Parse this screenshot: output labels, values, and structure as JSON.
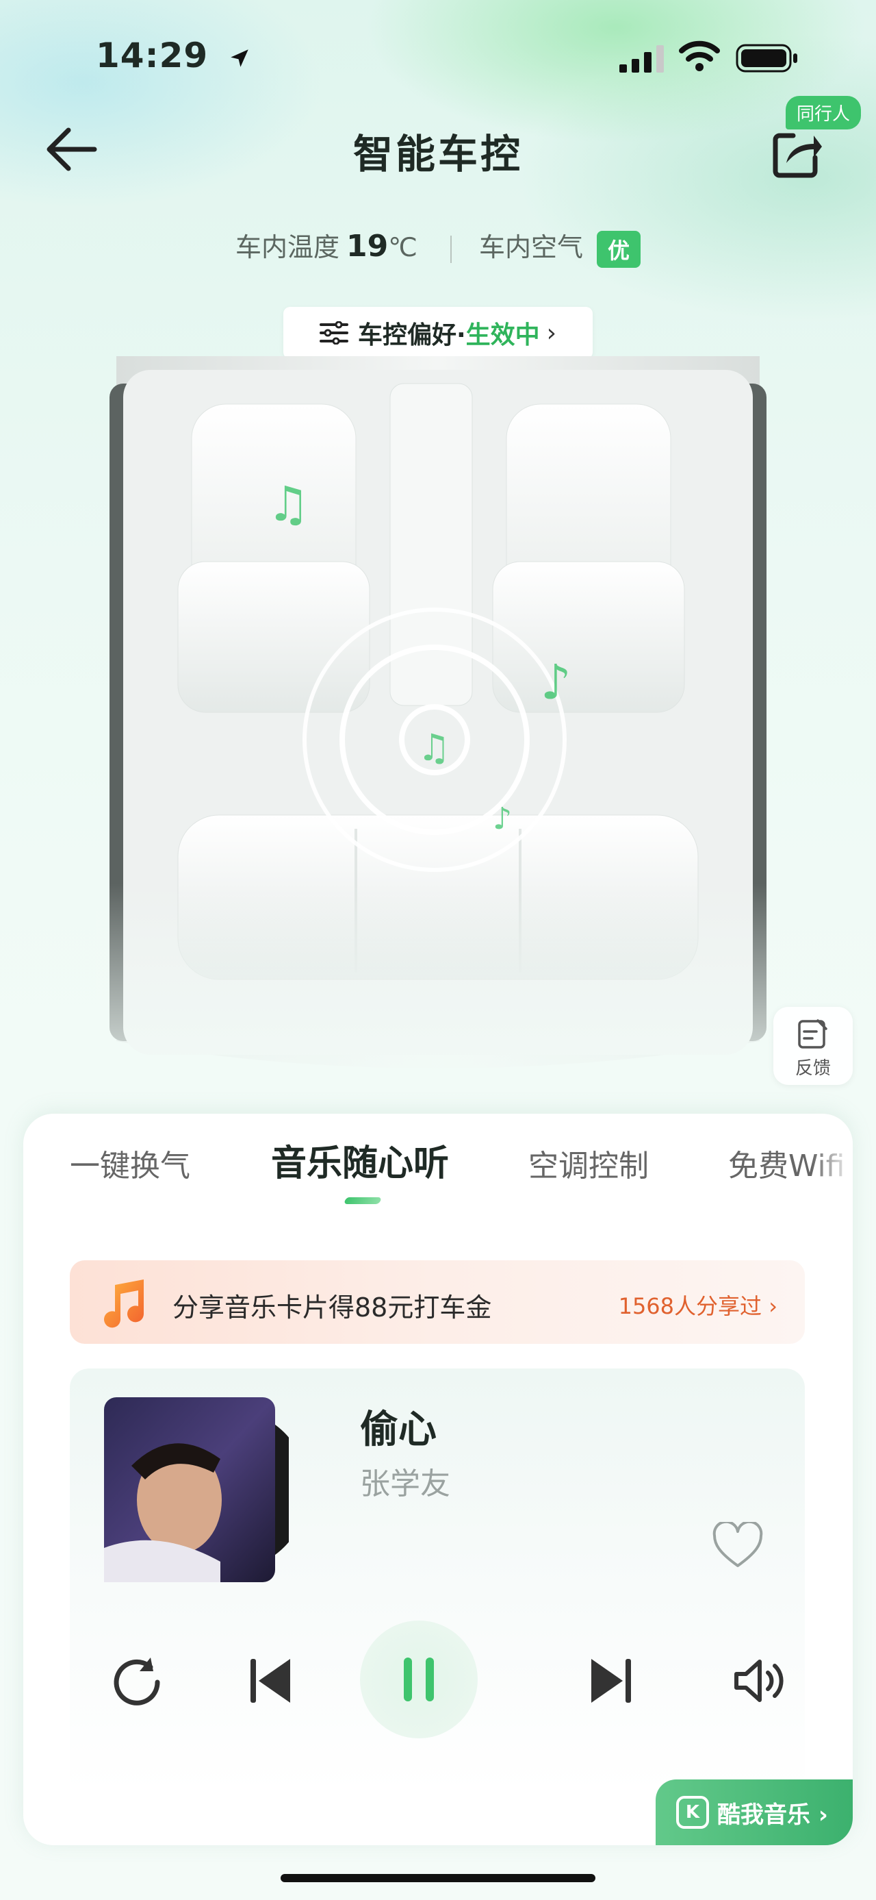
{
  "status_bar": {
    "time": "14:29"
  },
  "nav": {
    "title": "智能车控",
    "companion_badge": "同行人"
  },
  "env": {
    "temp_label": "车内温度",
    "temp_value": "19",
    "temp_unit": "℃",
    "air_label": "车内空气",
    "air_badge": "优"
  },
  "preference": {
    "label": "车控偏好·",
    "status": "生效中",
    "chevron": "›"
  },
  "feedback": {
    "label": "反馈"
  },
  "tabs": [
    {
      "label": "一键换气",
      "active": false
    },
    {
      "label": "音乐随心听",
      "active": true
    },
    {
      "label": "空调控制",
      "active": false
    },
    {
      "label": "免费Wifi",
      "active": false
    }
  ],
  "promo": {
    "text": "分享音乐卡片得88元打车金",
    "count": "1568人分享过 ›"
  },
  "player": {
    "song": "偷心",
    "artist": "张学友",
    "state": "playing",
    "accent_color": "#3ec46d"
  },
  "brand_button": {
    "label": "酷我音乐 ›"
  },
  "icons": {
    "back": "arrow-left-icon",
    "share": "share-icon",
    "preference": "sliders-icon",
    "feedback": "edit-icon",
    "heart": "heart-icon",
    "repeat": "repeat-icon",
    "prev": "skip-previous-icon",
    "pause": "pause-icon",
    "next": "skip-next-icon",
    "volume": "volume-icon"
  }
}
